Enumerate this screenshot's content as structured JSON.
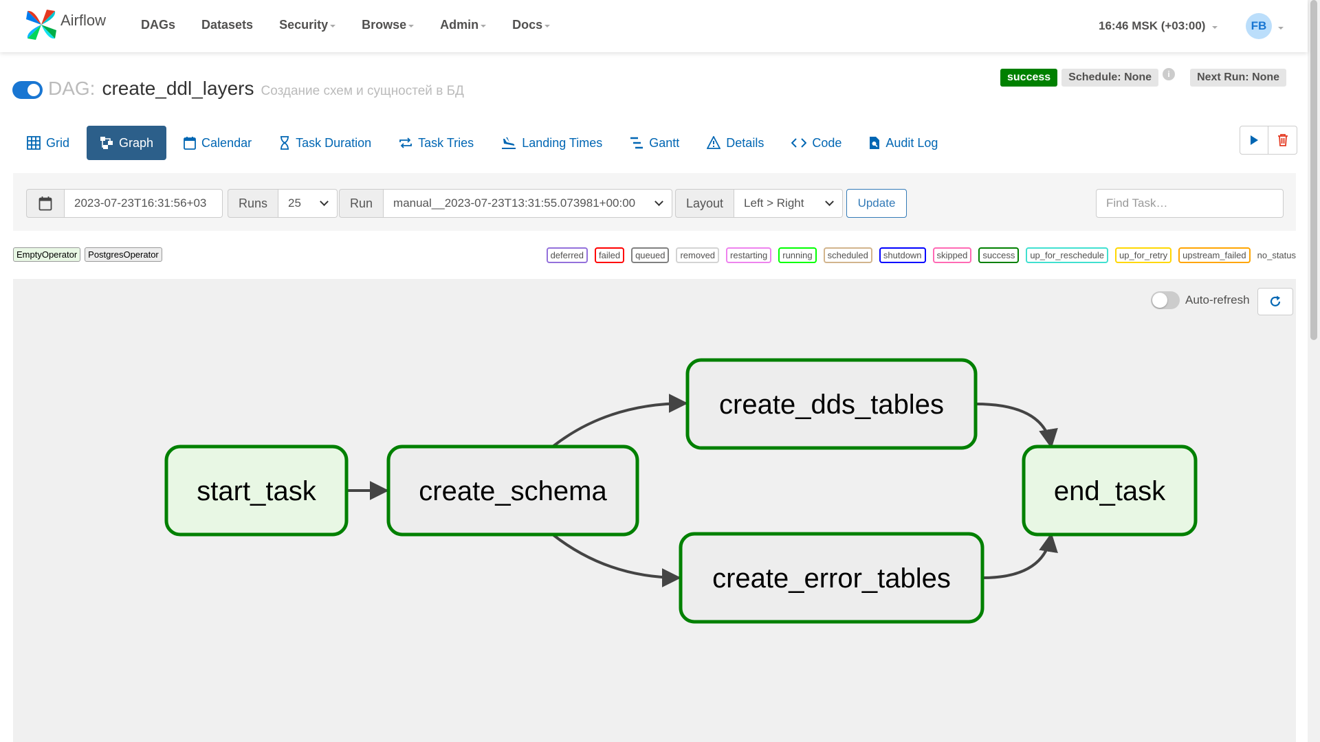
{
  "navbar": {
    "brand": "Airflow",
    "items": [
      {
        "label": "DAGs",
        "dropdown": false
      },
      {
        "label": "Datasets",
        "dropdown": false
      },
      {
        "label": "Security",
        "dropdown": true
      },
      {
        "label": "Browse",
        "dropdown": true
      },
      {
        "label": "Admin",
        "dropdown": true
      },
      {
        "label": "Docs",
        "dropdown": true
      }
    ],
    "clock": "16:46 MSK (+03:00)",
    "user_initials": "FB"
  },
  "dag": {
    "prefix": "DAG:",
    "id": "create_ddl_layers",
    "description": "Создание схем и сущностей в БД",
    "paused": false,
    "status": "success",
    "schedule": "Schedule: None",
    "next_run": "Next Run: None"
  },
  "tabs": [
    {
      "label": "Grid",
      "icon": "grid-icon",
      "active": false
    },
    {
      "label": "Graph",
      "icon": "graph-icon",
      "active": true
    },
    {
      "label": "Calendar",
      "icon": "calendar-icon",
      "active": false
    },
    {
      "label": "Task Duration",
      "icon": "hourglass-icon",
      "active": false
    },
    {
      "label": "Task Tries",
      "icon": "repeat-icon",
      "active": false
    },
    {
      "label": "Landing Times",
      "icon": "landing-icon",
      "active": false
    },
    {
      "label": "Gantt",
      "icon": "gantt-icon",
      "active": false
    },
    {
      "label": "Details",
      "icon": "warning-icon",
      "active": false
    },
    {
      "label": "Code",
      "icon": "code-icon",
      "active": false
    },
    {
      "label": "Audit Log",
      "icon": "audit-log-icon",
      "active": false
    }
  ],
  "filters": {
    "base_date": "2023-07-23T16:31:56+03",
    "runs_label": "Runs",
    "runs_value": "25",
    "run_label": "Run",
    "run_value": "manual__2023-07-23T13:31:55.073981+00:00",
    "layout_label": "Layout",
    "layout_value": "Left > Right",
    "update_label": "Update",
    "find_task_placeholder": "Find Task…"
  },
  "operators": [
    {
      "name": "EmptyOperator",
      "color": "#e8f7e4"
    },
    {
      "name": "PostgresOperator",
      "color": "#ededed"
    }
  ],
  "states": [
    {
      "name": "deferred",
      "color": "#9370db"
    },
    {
      "name": "failed",
      "color": "#ff0000"
    },
    {
      "name": "queued",
      "color": "#808080"
    },
    {
      "name": "removed",
      "color": "#d3d3d3"
    },
    {
      "name": "restarting",
      "color": "#ee82ee"
    },
    {
      "name": "running",
      "color": "#00ff00"
    },
    {
      "name": "scheduled",
      "color": "#d2b48c"
    },
    {
      "name": "shutdown",
      "color": "#0000ff"
    },
    {
      "name": "skipped",
      "color": "#ff69b4"
    },
    {
      "name": "success",
      "color": "#008000"
    },
    {
      "name": "up_for_reschedule",
      "color": "#40e0d0"
    },
    {
      "name": "up_for_retry",
      "color": "#ffd700"
    },
    {
      "name": "upstream_failed",
      "color": "#ffa500"
    },
    {
      "name": "no_status",
      "color": ""
    }
  ],
  "graph": {
    "auto_refresh_label": "Auto-refresh",
    "auto_refresh_on": false,
    "nodes": [
      {
        "id": "start_task",
        "label": "start_task",
        "operator": "EmptyOperator",
        "state": "success"
      },
      {
        "id": "create_schema",
        "label": "create_schema",
        "operator": "PostgresOperator",
        "state": "success"
      },
      {
        "id": "create_dds_tables",
        "label": "create_dds_tables",
        "operator": "PostgresOperator",
        "state": "success"
      },
      {
        "id": "create_error_tables",
        "label": "create_error_tables",
        "operator": "PostgresOperator",
        "state": "success"
      },
      {
        "id": "end_task",
        "label": "end_task",
        "operator": "EmptyOperator",
        "state": "success"
      }
    ],
    "edges": [
      {
        "from": "start_task",
        "to": "create_schema"
      },
      {
        "from": "create_schema",
        "to": "create_dds_tables"
      },
      {
        "from": "create_schema",
        "to": "create_error_tables"
      },
      {
        "from": "create_dds_tables",
        "to": "end_task"
      },
      {
        "from": "create_error_tables",
        "to": "end_task"
      }
    ]
  }
}
